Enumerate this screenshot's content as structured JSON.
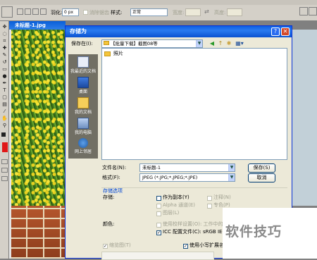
{
  "ps_options": {
    "feather_label": "羽化:",
    "feather_value": "0 px",
    "antialias_label": "消除锯齿",
    "style_label": "样式:",
    "style_value": "正常",
    "width_label": "宽度:",
    "height_label": "高度:"
  },
  "document": {
    "title": "未标题-1.jpg",
    "grass_title": "1"
  },
  "dialog": {
    "title": "存储为",
    "save_in_label": "保存在(I):",
    "save_in_value": "【批量下载】截图08等",
    "places": [
      {
        "label": "我最近的文档",
        "icon": "recent-documents-icon"
      },
      {
        "label": "桌面",
        "icon": "desktop-icon"
      },
      {
        "label": "我的文档",
        "icon": "my-documents-icon"
      },
      {
        "label": "我的电脑",
        "icon": "my-computer-icon"
      },
      {
        "label": "网上邻居",
        "icon": "network-places-icon"
      }
    ],
    "files": [
      {
        "name": "照片",
        "icon": "folder-icon"
      }
    ],
    "filename_label": "文件名(N):",
    "filename_value": "未标题-1",
    "format_label": "格式(F):",
    "format_value": "JPEG (*.JPG;*.JPEG;*.JPE)",
    "save_button": "保存(S)",
    "cancel_button": "取消",
    "options_title": "存储选项",
    "storage_label": "存储:",
    "as_copy": "作为副本(Y)",
    "notes": "注释(N)",
    "alpha": "Alpha 通道(E)",
    "spot": "专色(P)",
    "layers": "图层(L)",
    "color_label": "颜色:",
    "proof": "使用校样设置(O): 工作中的",
    "icc": "ICC 配置文件(C): sRGB IEC61",
    "thumbnail": "缩览图(T)",
    "lowercase_ext": "使用小写扩展名"
  },
  "watermark": "软件技巧"
}
